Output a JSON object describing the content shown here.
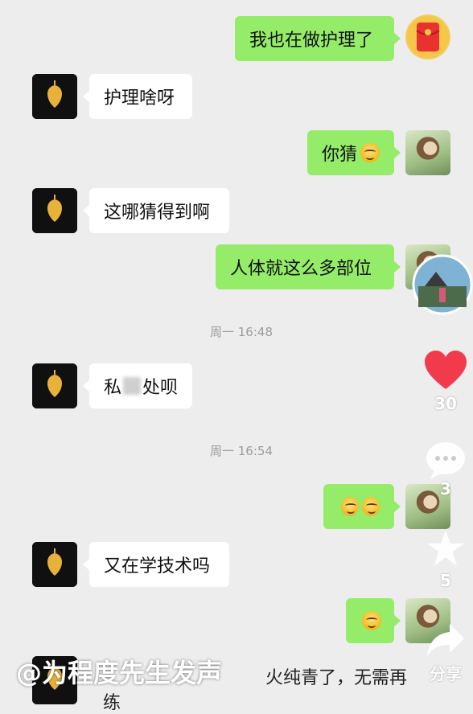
{
  "messages": [
    {
      "from": "self",
      "text": "我也在做护理了"
    },
    {
      "from": "other",
      "text": "护理啥呀"
    },
    {
      "from": "self",
      "text": "你猜"
    },
    {
      "from": "other",
      "text": "这哪猜得到啊"
    },
    {
      "from": "self",
      "text": "人体就这么多部位"
    },
    {
      "from": "other",
      "text_before": "私",
      "text_after": "处呗"
    },
    {
      "from": "self",
      "text": ""
    },
    {
      "from": "other",
      "text": "又在学技术吗"
    },
    {
      "from": "self",
      "text": ""
    }
  ],
  "timestamps": [
    "周一 16:48",
    "周一 16:54"
  ],
  "side_actions": {
    "like_count": "30",
    "comment_count": "3",
    "favorite_count": "5",
    "share_label": "分享"
  },
  "overlay": {
    "watermark": "@为程度先生发声",
    "caption_line1": "火纯青了，无需再",
    "caption_line2": "练"
  },
  "colors": {
    "bubble_self": "#95ec69",
    "bubble_other": "#ffffff",
    "background": "#ededed",
    "like": "#f23a4d"
  }
}
